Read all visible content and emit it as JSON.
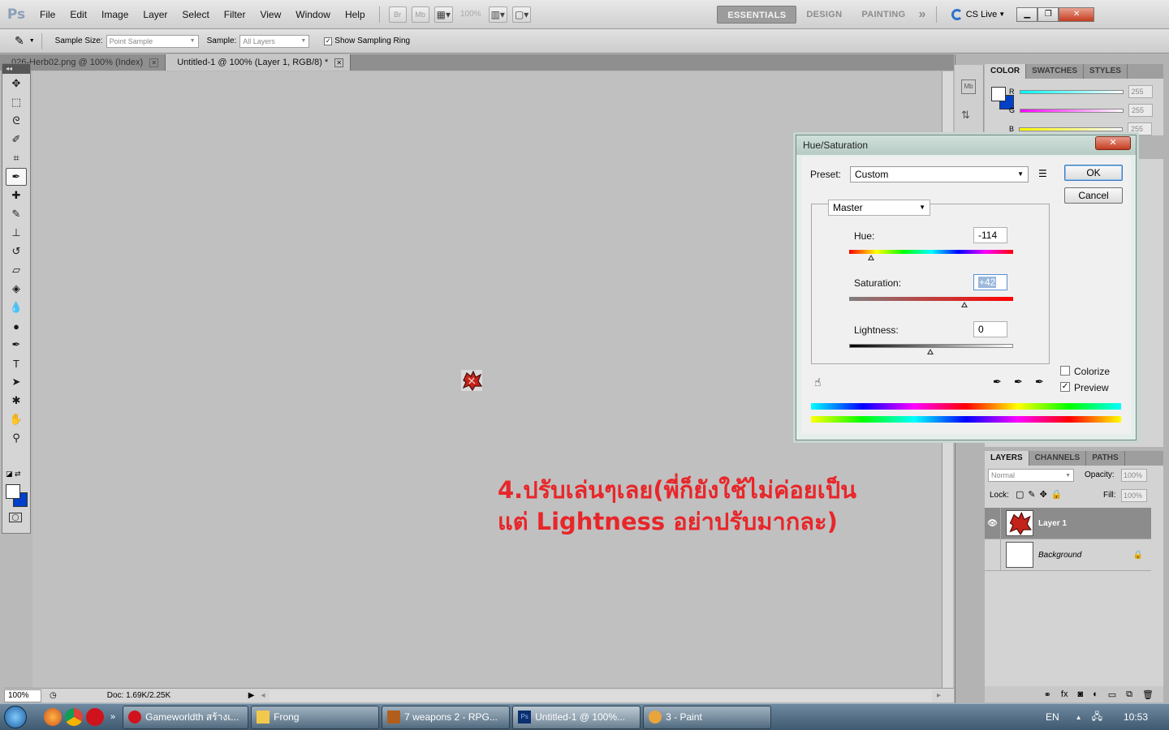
{
  "app": {
    "logo": "Ps",
    "menus": [
      "File",
      "Edit",
      "Image",
      "Layer",
      "Select",
      "Filter",
      "View",
      "Window",
      "Help"
    ],
    "toolbar": {
      "bridge": "Br",
      "minibridge": "Mb",
      "zoom": "100%"
    },
    "workspaces": [
      "ESSENTIALS",
      "DESIGN",
      "PAINTING"
    ],
    "workspace_more": "»",
    "cslive": "CS Live"
  },
  "options": {
    "sample_size_label": "Sample Size:",
    "sample_size_value": "Point Sample",
    "sample_label": "Sample:",
    "sample_value": "All Layers",
    "show_ring_label": "Show Sampling Ring",
    "show_ring_checked": true
  },
  "doc_tabs": [
    {
      "label": "026-Herb02.png @ 100% (Index)",
      "active": false
    },
    {
      "label": "Untitled-1 @ 100% (Layer 1, RGB/8) *",
      "active": true
    }
  ],
  "annotation": "4.ปรับเล่นๆเลย(พี่ก็ยังใช้ไม่ค่อยเป็น แต่ Lightness อย่าปรับมากละ)",
  "status": {
    "zoom": "100%",
    "doc": "Doc: 1.69K/2.25K"
  },
  "color_panel": {
    "tabs": [
      "COLOR",
      "SWATCHES",
      "STYLES"
    ],
    "r_label": "R",
    "r_value": "255",
    "g_label": "G",
    "g_value": "255",
    "b_label": "B",
    "b_value": "255"
  },
  "layers_panel": {
    "tabs": [
      "LAYERS",
      "CHANNELS",
      "PATHS"
    ],
    "blend_mode": "Normal",
    "opacity_label": "Opacity:",
    "opacity_value": "100%",
    "lock_label": "Lock:",
    "fill_label": "Fill:",
    "fill_value": "100%",
    "layers": [
      {
        "name": "Layer 1",
        "selected": true,
        "visible": true
      },
      {
        "name": "Background",
        "selected": false,
        "visible": false
      }
    ]
  },
  "dialog": {
    "title": "Hue/Saturation",
    "close": "✕",
    "preset_label": "Preset:",
    "preset_value": "Custom",
    "ok": "OK",
    "cancel": "Cancel",
    "channel": "Master",
    "hue_label": "Hue:",
    "hue_value": "-114",
    "saturation_label": "Saturation:",
    "saturation_value": "+42",
    "lightness_label": "Lightness:",
    "lightness_value": "0",
    "colorize_label": "Colorize",
    "colorize_checked": false,
    "preview_label": "Preview",
    "preview_checked": true
  },
  "taskbar": {
    "items": [
      {
        "label": "Gameworldth สร้างเ...",
        "icon_color": "#d0121c",
        "active": false
      },
      {
        "label": "Frong",
        "icon_color": "#f2c94c",
        "active": false
      },
      {
        "label": "7 weapons 2 - RPG...",
        "icon_color": "#b15e1c",
        "active": false
      },
      {
        "label": "Untitled-1 @ 100%...",
        "icon_color": "#0c2f6d",
        "active": true
      },
      {
        "label": "3 - Paint",
        "icon_color": "#e8a53b",
        "active": false
      }
    ],
    "lang": "EN",
    "clock": "10:53"
  }
}
